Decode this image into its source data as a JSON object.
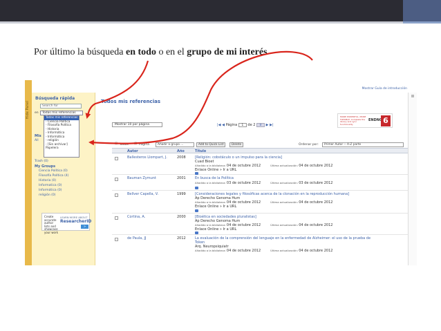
{
  "caption": {
    "prefix": "Por último la búsqueda ",
    "bold1": "en todo",
    "middle": " o en el ",
    "bold2": "grupo de mi interés"
  },
  "side_stripe_label": "Hide Panel",
  "quick_search": {
    "title": "Búsqueda rápida",
    "search_value": "Search for",
    "in_label": "en",
    "in_value": "Todas mis referencias",
    "options": [
      "Todas mis referencias",
      "- Ciencia Política",
      "- Filosofía Política",
      "- Historia",
      "- Informática",
      "- Informática",
      "- religión",
      "- [Sin archivar]",
      "Papelera"
    ]
  },
  "sidebar": {
    "mis": "Mis",
    "all": "All",
    "trash": "Trash (0)",
    "groups_header": "My Groups",
    "groups": [
      "Ciencia Política (0)",
      "Filosofía Política (4)",
      "Historia (0)",
      "Informatica (0)",
      "Informática (0)",
      "religión (0)"
    ]
  },
  "researcher_ad": {
    "create": "Create accurate author lists and showcase your work",
    "learn": "LEARN MORE ABOUT",
    "brand": "ResearcherID",
    "go": ">"
  },
  "top_link": "Mostrar Guía de introducción",
  "main_title": "Todos mis referencias",
  "endnote_ad": {
    "tagline": "MORE POWERFUL, MORE FLEXIBLE. Complete the library and sync functionality",
    "brand": "ENDNOTE",
    "version": "6"
  },
  "per_page": "Mostrar 10 por página",
  "pager": {
    "page_label": "Página",
    "page_value": "1",
    "of_label": "de 2",
    "go": "Ir"
  },
  "toolbar": {
    "all": "Todos",
    "page": "Página",
    "add_group": "Añadir a grupo ...",
    "quick_list": "Add to Quick List",
    "delete": "Delete",
    "sort_label": "Ordenar por:",
    "sort_value": "Primer Autor -- A-Z parte"
  },
  "columns": {
    "author": "Autor",
    "year": "Año",
    "title": "Título"
  },
  "labels": {
    "added": "Añadido a la biblioteca:",
    "updated": "Última actualización:",
    "link": "Enlace Online » Ir a URL"
  },
  "references": [
    {
      "author": "Ballesteros Llompart, J.",
      "year": "2008",
      "title": "[Religión: cobstáculo o un impulso para la ciencia]",
      "source": "Cuad Bioet",
      "added": "04 de octubre 2012",
      "updated": "04 de octubre 2012"
    },
    {
      "author": "Bauman Zymunt",
      "year": "2001",
      "title": "En busca de la Política",
      "source": "",
      "added": "03 de octubre 2012",
      "updated": "03 de octubre 2012"
    },
    {
      "author": "Bellver Capella, V.",
      "year": "1999",
      "title": "[Consideraciones legales y filosóficas acerca de la clonación en la reproducción humana]",
      "source": "Ap Derecho Genoma Hum",
      "added": "04 de octubre 2012",
      "updated": "04 de octubre 2012"
    },
    {
      "author": "Cortina, A.",
      "year": "2000",
      "title": "[Bioética en sociedades pluralistas]",
      "source": "Ap Derecho Genoma Hum",
      "added": "04 de octubre 2012",
      "updated": "04 de octubre 2012"
    },
    {
      "author": "de Paula, JJ",
      "year": "2012",
      "title": "La evaluación de la comprensión del lenguaje en la enfermedad de Alzheimer: el uso de la prueba de",
      "title2": "Token",
      "source": "Arq. Neuropsiquiatr",
      "added": "04 de octubre 2012",
      "updated": "04 de octubre 2012"
    }
  ],
  "colors": {
    "accent": "#3d62a8",
    "slide_bar": "#2b2b33",
    "slide_accent": "#4c5d83",
    "annotation_arrow": "#d9251c",
    "panel_bg": "#fdf3c6"
  }
}
